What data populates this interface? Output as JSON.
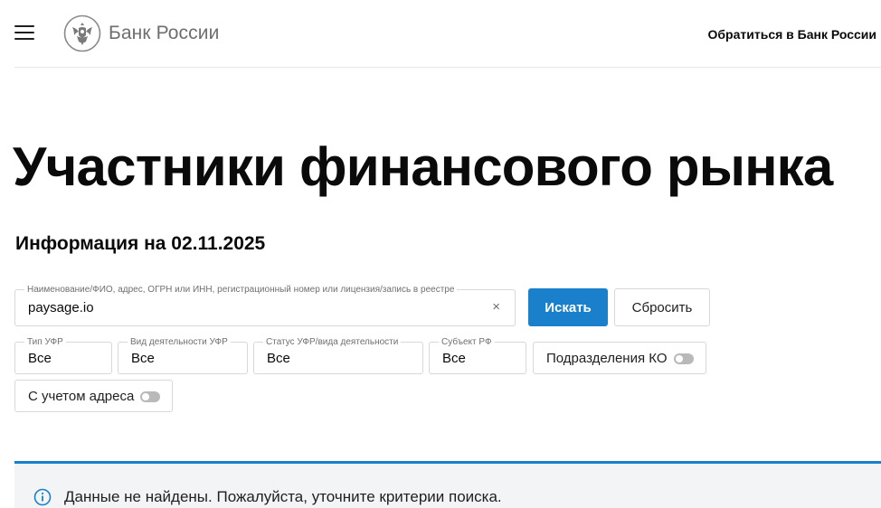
{
  "header": {
    "brand": "Банк России",
    "contact_link": "Обратиться в Банк России"
  },
  "page": {
    "title": "Участники финансового рынка",
    "info_date": "Информация на 02.11.2025"
  },
  "search": {
    "label": "Наименование/ФИО, адрес, ОГРН или ИНН, регистрационный номер или лицензия/запись в реестре",
    "value": "paysage.io",
    "clear_symbol": "×",
    "search_button": "Искать",
    "reset_button": "Сбросить"
  },
  "filters": {
    "ufr_type": {
      "label": "Тип УФР",
      "value": "Все"
    },
    "activity_type": {
      "label": "Вид деятельности УФР",
      "value": "Все"
    },
    "status": {
      "label": "Статус УФР/вида деятельности",
      "value": "Все"
    },
    "region": {
      "label": "Субъект РФ",
      "value": "Все"
    },
    "ko_divisions": {
      "label": "Подразделения КО",
      "enabled": false
    },
    "with_address": {
      "label": "С учетом адреса",
      "enabled": false
    }
  },
  "notice": {
    "text": "Данные не найдены. Пожалуйста, уточните критерии поиска."
  },
  "colors": {
    "accent": "#1a80cc",
    "notice_bg": "#f3f4f6",
    "brand_gray": "#6e6e6e"
  },
  "icons": {
    "menu": "hamburger-icon",
    "logo": "double-headed-eagle-emblem",
    "clear": "close-icon",
    "notice": "info-circle-icon"
  }
}
